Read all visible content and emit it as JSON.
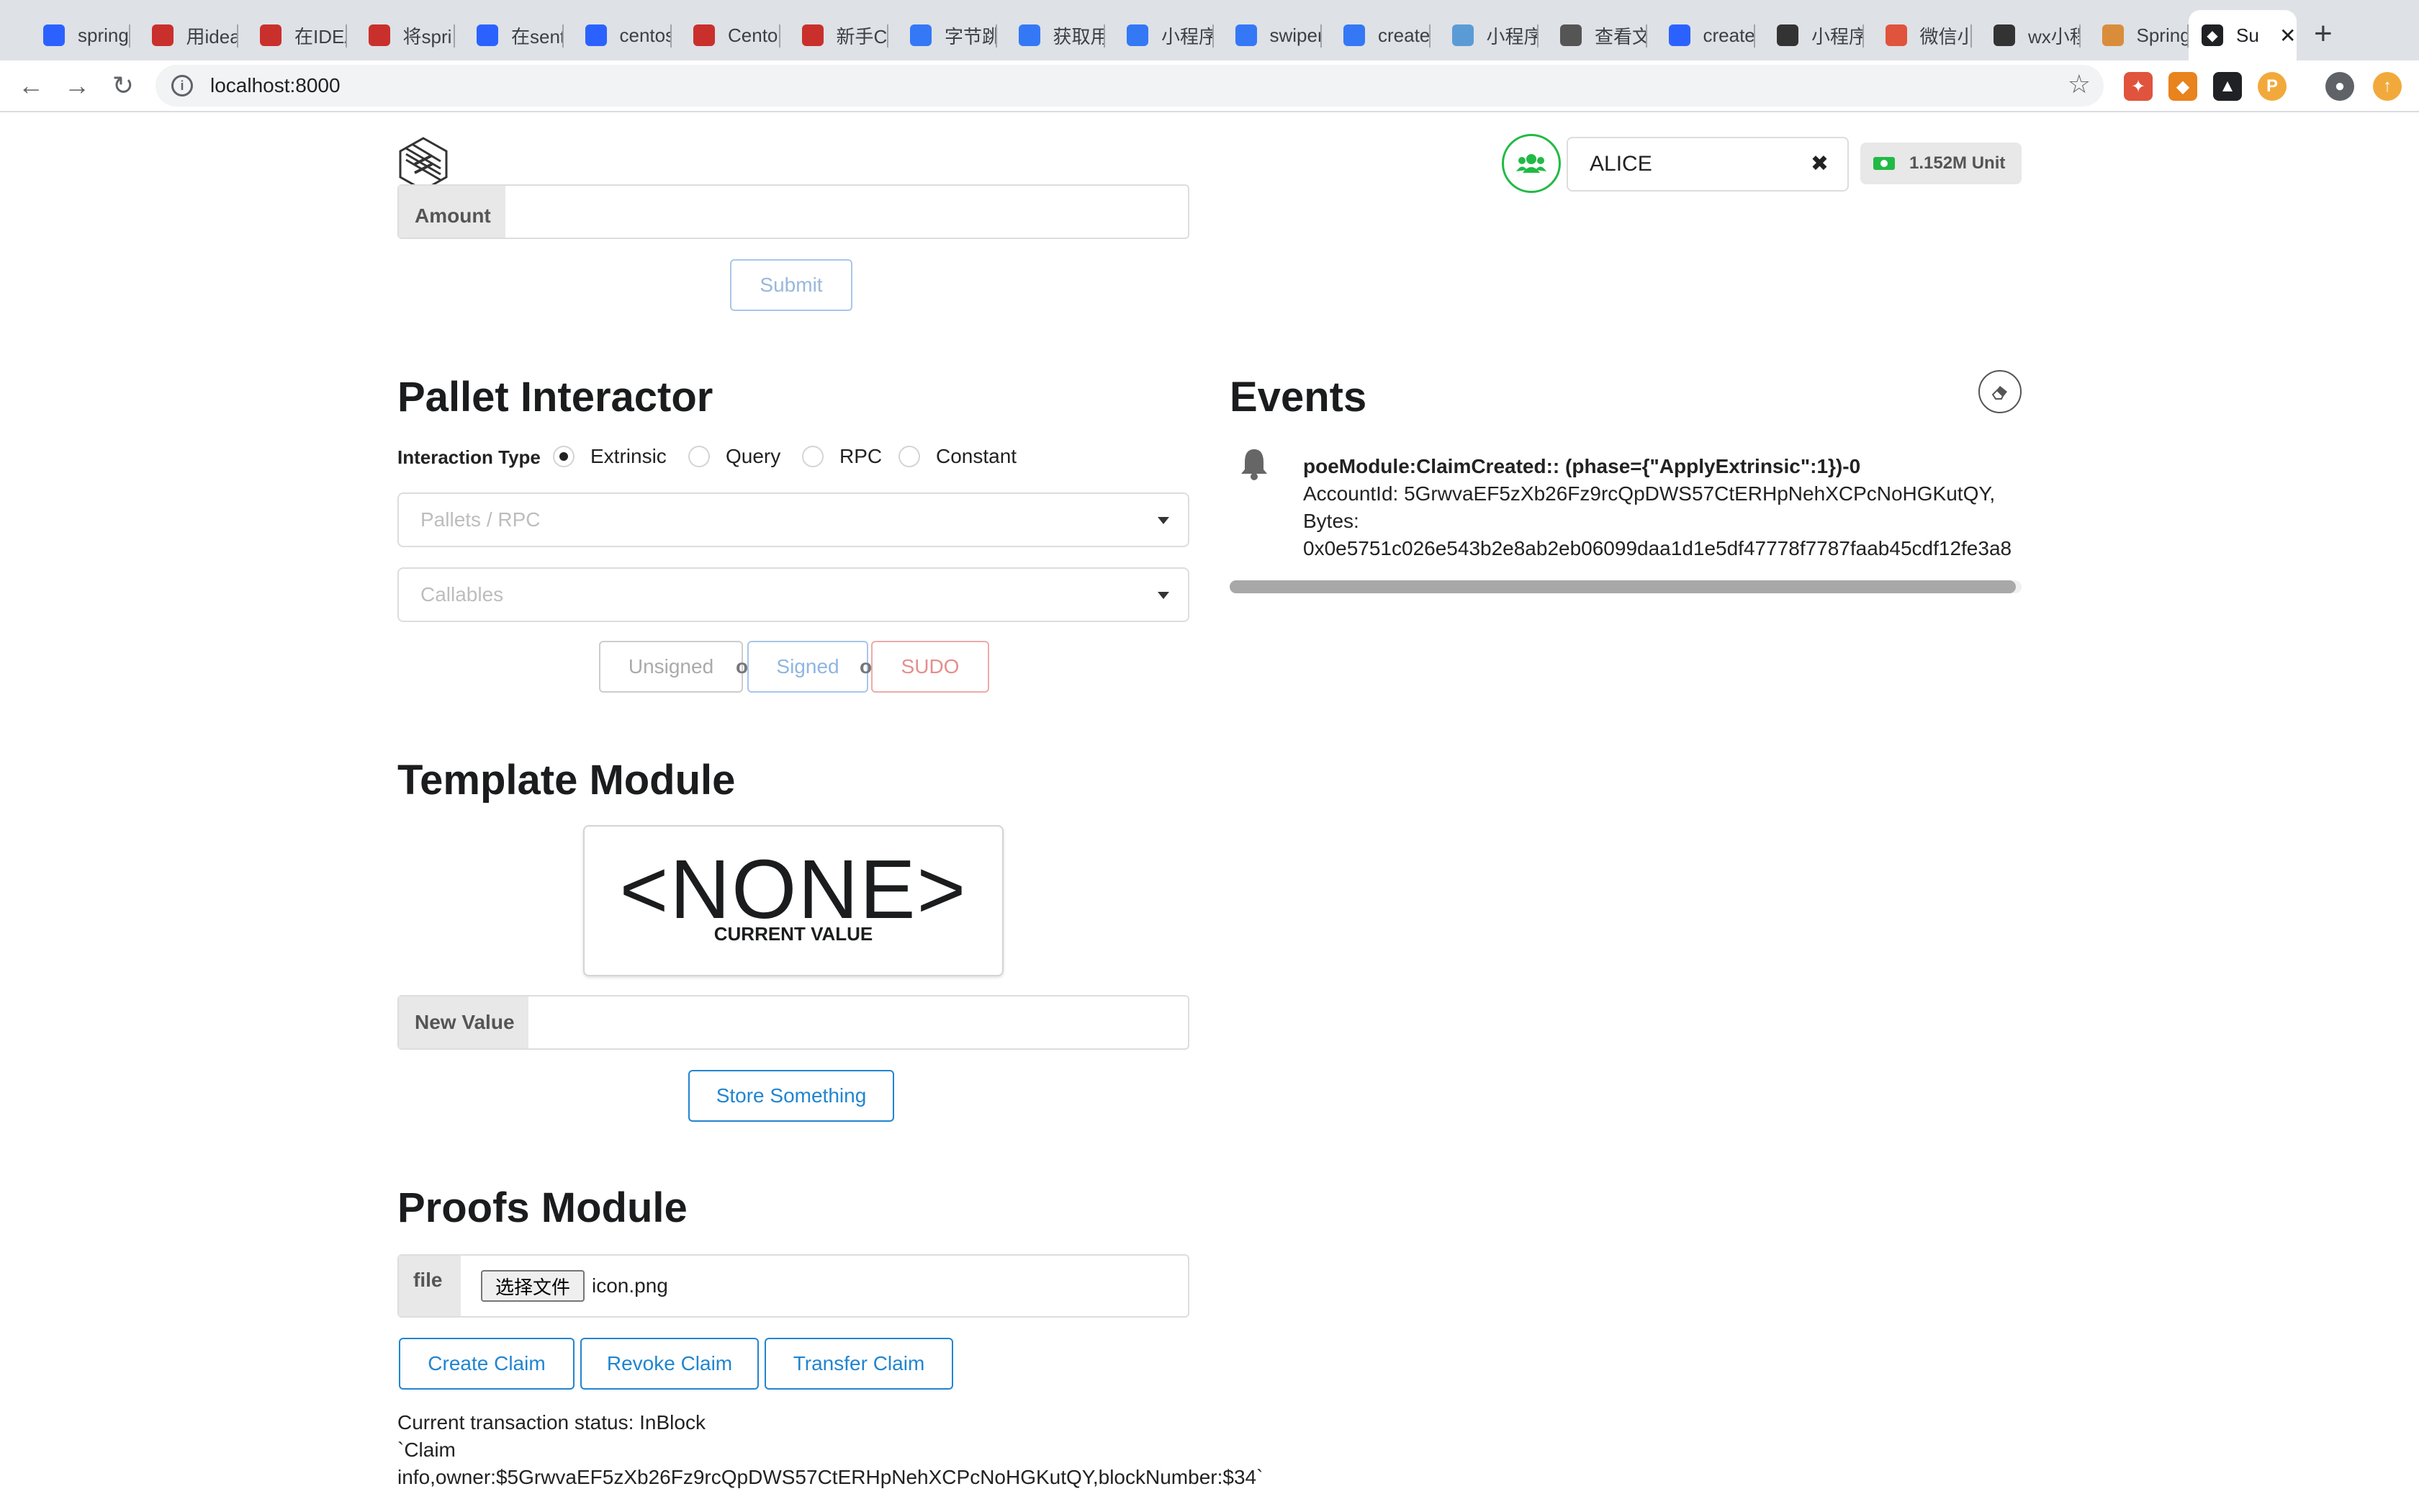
{
  "browser": {
    "tabs": [
      {
        "label": "spring",
        "icon": "paw-icon",
        "color": "#2b62ff"
      },
      {
        "label": "用idea",
        "icon": "csdn-icon",
        "color": "#c9302c"
      },
      {
        "label": "在IDEA",
        "icon": "csdn-icon",
        "color": "#c9302c"
      },
      {
        "label": "将spri",
        "icon": "csdn-icon",
        "color": "#c9302c"
      },
      {
        "label": "在sent",
        "icon": "paw-icon",
        "color": "#2b62ff"
      },
      {
        "label": "centos",
        "icon": "paw-icon",
        "color": "#2b62ff"
      },
      {
        "label": "Cento",
        "icon": "csdn-icon",
        "color": "#c9302c"
      },
      {
        "label": "新手C",
        "icon": "csdn-icon",
        "color": "#c9302c"
      },
      {
        "label": "字节跳",
        "icon": "diamond-icon",
        "color": "#3478f6"
      },
      {
        "label": "获取用",
        "icon": "diamond-icon",
        "color": "#3478f6"
      },
      {
        "label": "小程序",
        "icon": "diamond-icon",
        "color": "#3478f6"
      },
      {
        "label": "swiper",
        "icon": "diamond-icon",
        "color": "#3478f6"
      },
      {
        "label": "create",
        "icon": "diamond-icon",
        "color": "#3478f6"
      },
      {
        "label": "小程序",
        "icon": "grid-icon",
        "color": "#5b9bd5"
      },
      {
        "label": "查看文",
        "icon": "globe-icon",
        "color": "#555555"
      },
      {
        "label": "create",
        "icon": "paw-icon",
        "color": "#2b62ff"
      },
      {
        "label": "小程序",
        "icon": "mini-icon",
        "color": "#333333"
      },
      {
        "label": "微信小",
        "icon": "doc-icon",
        "color": "#e0533d"
      },
      {
        "label": "wx小程",
        "icon": "mini-icon",
        "color": "#333333"
      },
      {
        "label": "Spring",
        "icon": "spring-icon",
        "color": "#d98d3a"
      }
    ],
    "active_tab": {
      "label": "Su",
      "close": "✕"
    },
    "new_tab": "+",
    "nav": {
      "back": "←",
      "forward": "→",
      "reload": "↻"
    },
    "url": "localhost:8000",
    "info_icon": "i",
    "star": "☆",
    "extensions": [
      {
        "name": "network-ext-icon",
        "color": "#e0533d",
        "glyph": "✦"
      },
      {
        "name": "metamask-ext-icon",
        "color": "#e8831d",
        "glyph": "◆"
      },
      {
        "name": "dark-ext-icon",
        "color": "#202124",
        "glyph": "▲"
      },
      {
        "name": "p-ext-icon",
        "color": "#f2a93b",
        "glyph": "P"
      },
      {
        "name": "profile-icon",
        "color": "#5f6368",
        "glyph": "●"
      },
      {
        "name": "update-icon",
        "color": "#f2a93b",
        "glyph": "↑"
      }
    ]
  },
  "header": {
    "account": "ALICE",
    "clear_x": "✖",
    "balance": "1.152M Unit"
  },
  "transfer": {
    "amount_label": "Amount",
    "submit": "Submit"
  },
  "pallet": {
    "title": "Pallet Interactor",
    "interaction_label": "Interaction Type",
    "types": [
      "Extrinsic",
      "Query",
      "RPC",
      "Constant"
    ],
    "selected_type": "Extrinsic",
    "pallets_placeholder": "Pallets / RPC",
    "callables_placeholder": "Callables",
    "btn_unsigned": "Unsigned",
    "btn_signed": "Signed",
    "btn_sudo": "SUDO",
    "or": "or"
  },
  "events": {
    "title": "Events",
    "items": [
      {
        "heading": "poeModule:ClaimCreated:: (phase={\"ApplyExtrinsic\":1})-0",
        "line1": "AccountId: 5GrwvaEF5zXb26Fz9rcQpDWS57CtERHpNehXCPcNoHGKutQY,",
        "line2": "Bytes:",
        "line3": "0x0e5751c026e543b2e8ab2eb06099daa1d1e5df47778f7787faab45cdf12fe3a8"
      }
    ]
  },
  "template": {
    "title": "Template Module",
    "current_value": "<NONE>",
    "current_caption": "CURRENT VALUE",
    "new_value_label": "New Value",
    "new_value": "",
    "store_button": "Store Something"
  },
  "proofs": {
    "title": "Proofs Module",
    "file_label": "file",
    "choose_file": "选择文件",
    "file_name": "icon.png",
    "create": "Create Claim",
    "revoke": "Revoke Claim",
    "transfer": "Transfer Claim",
    "status_line1": "Current transaction status: InBlock",
    "status_line2": "`Claim",
    "status_line3": "info,owner:$5GrwvaEF5zXb26Fz9rcQpDWS57CtERHpNehXCPcNoHGKutQY,blockNumber:$34`"
  },
  "colors": {
    "primary": "#2185d0",
    "green": "#21ba45",
    "sudo": "#db2828"
  }
}
